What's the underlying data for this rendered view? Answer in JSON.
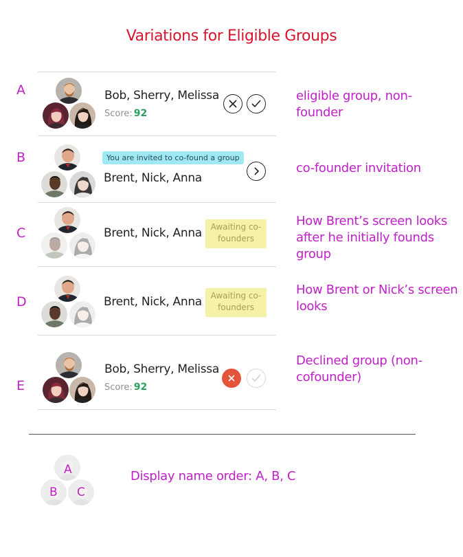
{
  "page": {
    "title": "Variations for Eligible Groups"
  },
  "rows": [
    {
      "letter": "A",
      "names": "Bob, Sherry, Melissa",
      "score_label": "Score:",
      "score_value": "92",
      "note": "eligible group, non-founder",
      "actions": [
        "decline-icon",
        "accept-icon"
      ]
    },
    {
      "letter": "B",
      "names": "Brent, Nick, Anna",
      "badge": "You are invited to co-found a group",
      "note": "co-founder invitation",
      "actions": [
        "chevron-right-icon"
      ]
    },
    {
      "letter": "C",
      "names": "Brent, Nick, Anna",
      "status": "Awaiting co-founders",
      "note": "How Brent’s screen looks after he initially founds group"
    },
    {
      "letter": "D",
      "names": "Brent, Nick, Anna",
      "status": "Awaiting co-founders",
      "note": "How Brent or Nick’s screen looks"
    },
    {
      "letter": "E",
      "names": "Bob, Sherry, Melissa",
      "score_label": "Score:",
      "score_value": "92",
      "note": "Declined group (non-cofounder)",
      "actions": [
        "declined-icon",
        "accept-icon"
      ]
    }
  ],
  "legend": {
    "positions": [
      "A",
      "B",
      "C"
    ],
    "text": "Display name order: A, B, C"
  },
  "colors": {
    "title": "#d8152d",
    "annotation": "#c020c8",
    "score": "#2aa05a",
    "declined": "#e4543a",
    "invite_badge": "#9ee9f4",
    "awaiting_badge": "#f5f1a6"
  }
}
